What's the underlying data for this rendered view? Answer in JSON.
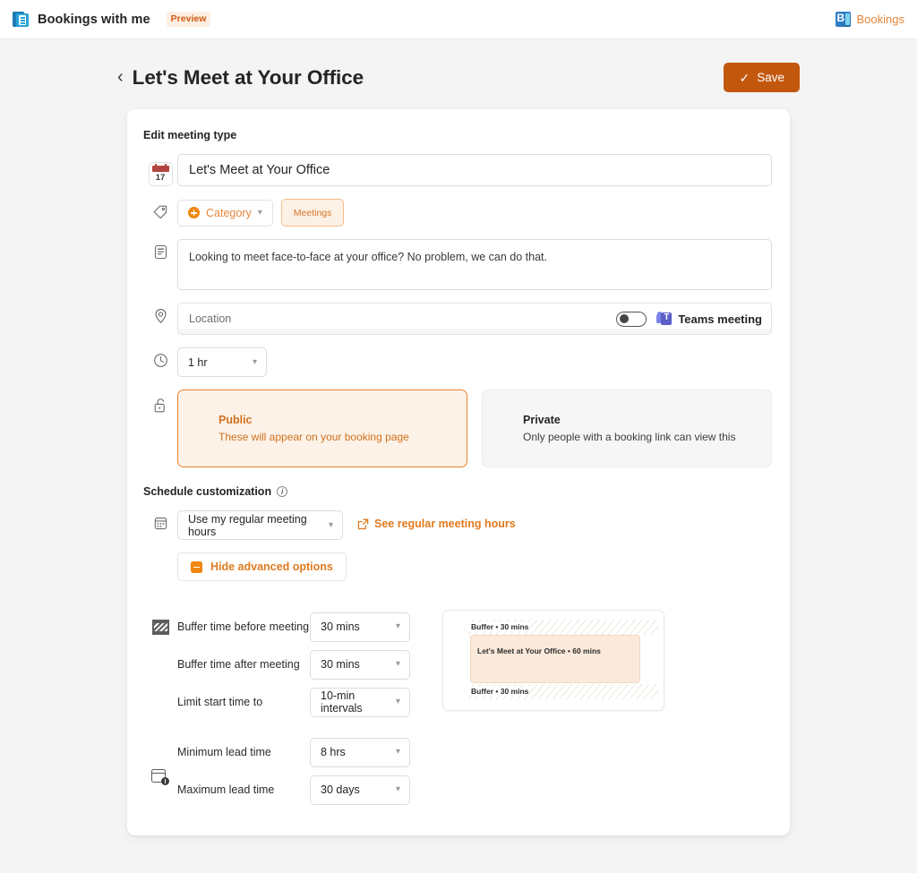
{
  "appbar": {
    "logo_icon": "bookings-with-me-logo",
    "title": "Bookings with me",
    "preview_badge": "Preview",
    "right_icon": "bookings-app-icon",
    "right_label": "Bookings"
  },
  "header": {
    "back_icon": "chevron-left-icon",
    "title": "Let's Meet at Your Office",
    "save_label": "Save",
    "save_icon": "check-icon",
    "save_color": "#c2570e"
  },
  "card": {
    "section_label": "Edit meeting type",
    "name_field": {
      "icon": "calendar-17-icon",
      "day_number": "17",
      "value": "Let's Meet at Your Office"
    },
    "category": {
      "icon": "tag-icon",
      "add_label": "Category",
      "chips": [
        "Meetings"
      ]
    },
    "description": {
      "icon": "notes-icon",
      "value": "Looking to meet face-to-face at your office?  No problem, we can do that."
    },
    "location": {
      "icon": "location-pin-icon",
      "placeholder": "Location",
      "toggle_on": false,
      "teams_icon": "teams-icon",
      "teams_label": "Teams meeting"
    },
    "duration": {
      "icon": "clock-icon",
      "value": "1 hr"
    },
    "visibility": {
      "icon": "unlock-icon",
      "options": [
        {
          "title": "Public",
          "subtitle": "These will appear on your booking page",
          "selected": true
        },
        {
          "title": "Private",
          "subtitle": "Only people with a booking link can view this",
          "selected": false
        }
      ]
    }
  },
  "schedule": {
    "label": "Schedule customization",
    "info_icon": "info-icon",
    "hours_icon": "calendar-grid-icon",
    "hours_value": "Use my regular meeting hours",
    "link_icon": "open-in-new-window-icon",
    "link_label": "See regular meeting hours",
    "advanced_icon": "minus-square-icon",
    "advanced_label": "Hide advanced options"
  },
  "advanced": {
    "buffer_icon": "buffer-hatch-icon",
    "lead_icon": "lead-time-icon",
    "rows": [
      {
        "label": "Buffer time before meeting",
        "value": "30 mins"
      },
      {
        "label": "Buffer time after meeting",
        "value": "30 mins"
      },
      {
        "label": "Limit start time to",
        "value": "10-min intervals"
      },
      {
        "label": "Minimum lead time",
        "value": "8 hrs"
      },
      {
        "label": "Maximum lead time",
        "value": "30 days"
      }
    ],
    "preview": {
      "buffer_before": "Buffer • 30 mins",
      "meeting": "Let's Meet at Your Office • 60 mins",
      "buffer_after": "Buffer • 30 mins"
    }
  }
}
